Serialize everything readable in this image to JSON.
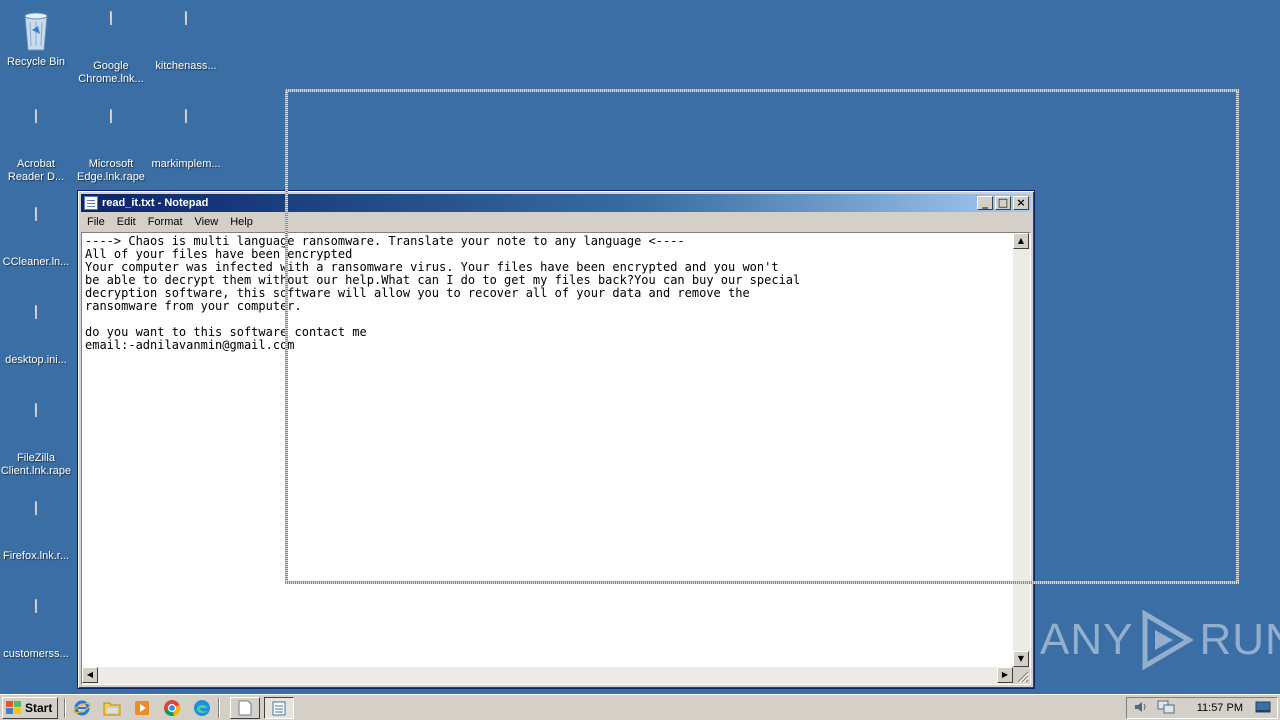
{
  "desktop": {
    "icons": [
      {
        "label": "Recycle Bin",
        "kind": "recycle-bin"
      },
      {
        "label": "Google Chrome.lnk...",
        "kind": "document"
      },
      {
        "label": "kitchenass...",
        "kind": "document"
      },
      {
        "label": "Acrobat Reader D...",
        "kind": "document"
      },
      {
        "label": "Microsoft Edge.lnk.rape",
        "kind": "document"
      },
      {
        "label": "markimplem...",
        "kind": "document"
      },
      {
        "label": "CCleaner.ln...",
        "kind": "document"
      },
      {
        "label": "desktop.ini...",
        "kind": "document"
      },
      {
        "label": "FileZilla Client.lnk.rape",
        "kind": "document"
      },
      {
        "label": "Firefox.lnk.r...",
        "kind": "document"
      },
      {
        "label": "customerss...",
        "kind": "document"
      }
    ]
  },
  "notepad": {
    "title": "read_it.txt - Notepad",
    "controls": {
      "minimize": "_",
      "maximize": "□",
      "close": "×"
    },
    "menu": [
      "File",
      "Edit",
      "Format",
      "View",
      "Help"
    ],
    "content": "----> Chaos is multi language ransomware. Translate your note to any language <----\nAll of your files have been encrypted\nYour computer was infected with a ransomware virus. Your files have been encrypted and you won't\nbe able to decrypt them without our help.What can I do to get my files back?You can buy our special\ndecryption software, this software will allow you to recover all of your data and remove the\nransomware from your computer.\n\ndo you want to this software contact me\nemail:-adnilavanmin@gmail.com"
  },
  "watermark": {
    "left": "ANY",
    "right": "RUN"
  },
  "taskbar": {
    "start_label": "Start",
    "quick_launch": [
      "ie-icon",
      "explorer-icon",
      "media-player-icon",
      "chrome-icon",
      "edge-icon"
    ],
    "clock": "11:57 PM"
  },
  "colors": {
    "desktop": "#3a6ea5",
    "titlebar_start": "#0a246a",
    "titlebar_end": "#a6caf0",
    "chrome": "#d4d0c8"
  }
}
